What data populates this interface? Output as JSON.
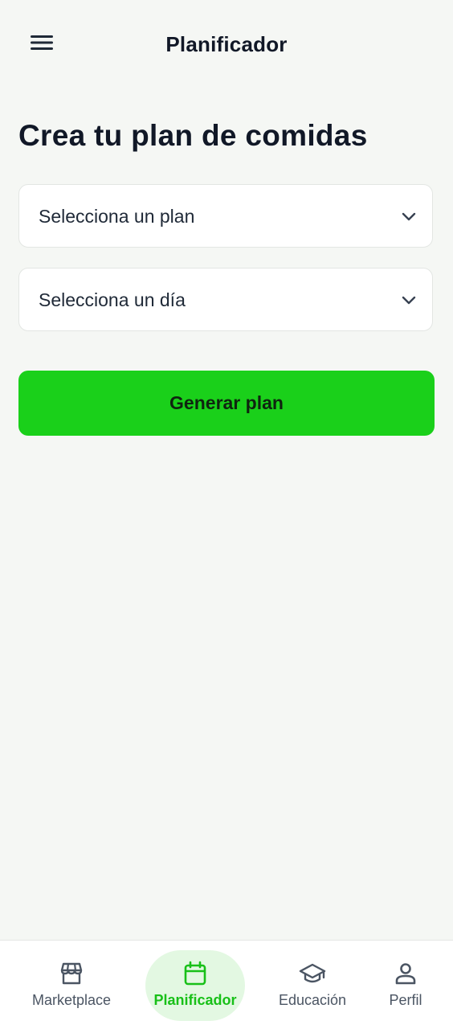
{
  "colors": {
    "background": "#f5f7f4",
    "primary_green": "#1ad01a",
    "active_nav_text": "#18c018",
    "active_nav_pill": "#e3f8e2",
    "text_dark": "#111827",
    "nav_inactive": "#4b5563"
  },
  "header": {
    "menu_icon": "hamburger-menu-icon",
    "title": "Planificador"
  },
  "main": {
    "heading": "Crea tu plan de comidas",
    "plan_select": {
      "value": "Selecciona un plan",
      "icon": "chevron-down-icon"
    },
    "day_select": {
      "value": "Selecciona un día",
      "icon": "chevron-down-icon"
    },
    "generate_button_label": "Generar plan"
  },
  "bottom_nav": {
    "items": [
      {
        "label": "Marketplace",
        "icon": "store-icon",
        "active": false
      },
      {
        "label": "Planificador",
        "icon": "calendar-icon",
        "active": true
      },
      {
        "label": "Educación",
        "icon": "graduation-cap-icon",
        "active": false
      },
      {
        "label": "Perfil",
        "icon": "person-icon",
        "active": false
      }
    ]
  }
}
